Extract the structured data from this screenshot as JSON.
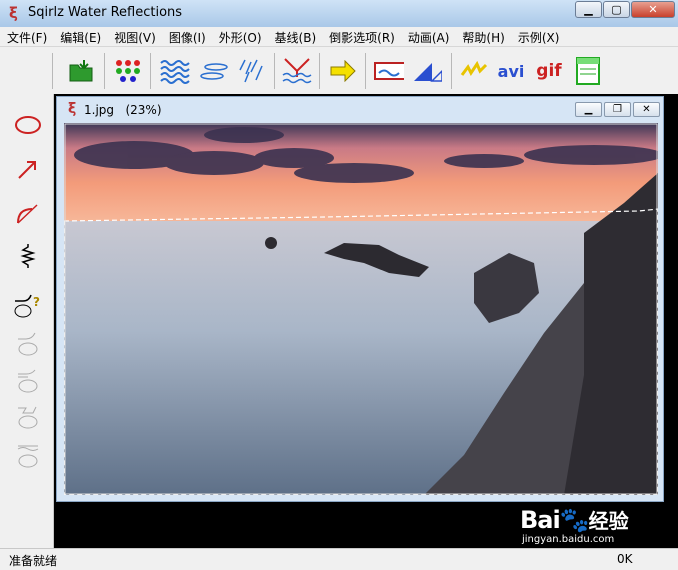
{
  "app": {
    "title": "Sqirlz Water Reflections"
  },
  "menu": [
    "文件(F)",
    "编辑(E)",
    "视图(V)",
    "图像(I)",
    "外形(O)",
    "基线(B)",
    "倒影选项(R)",
    "动画(A)",
    "帮助(H)",
    "示例(X)"
  ],
  "toolbar": [
    {
      "name": "open-icon"
    },
    {
      "name": "color-dots-icon"
    },
    {
      "name": "waves-icon"
    },
    {
      "name": "ripples-icon"
    },
    {
      "name": "rain-icon"
    },
    {
      "name": "reflect-icon"
    },
    {
      "name": "arrow-right-icon"
    },
    {
      "name": "frame-icon"
    },
    {
      "name": "triangle-icon"
    },
    {
      "name": "sparkle-icon"
    },
    {
      "name": "avi-icon",
      "label": "avi"
    },
    {
      "name": "gif-icon",
      "label": "gif"
    },
    {
      "name": "panel-icon"
    }
  ],
  "document": {
    "title": "1.jpg",
    "zoom": "(23%)"
  },
  "status": {
    "left": "准备就绪",
    "right": "0K"
  },
  "watermark": {
    "logo": "Bai",
    "cn": "经验",
    "url": "jingyan.baidu.com"
  },
  "colors": {
    "accent": "#cc2222",
    "sky_top": "#2e3a5c",
    "sky_glow": "#f08060",
    "sea": "#9fb3c8"
  }
}
